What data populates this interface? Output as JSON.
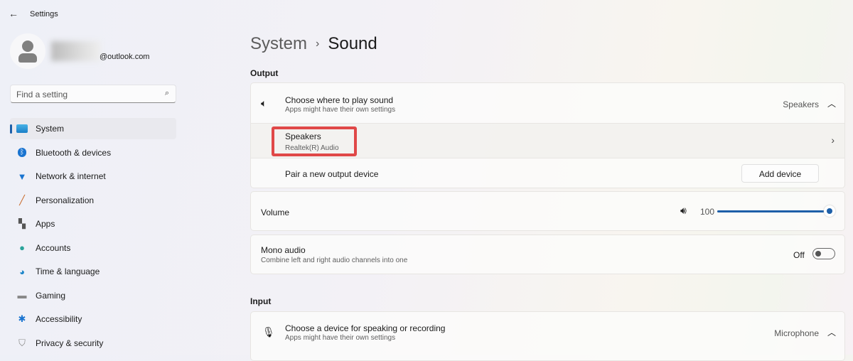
{
  "app": {
    "title": "Settings"
  },
  "account": {
    "email": "@outlook.com"
  },
  "search": {
    "placeholder": "Find a setting"
  },
  "nav": [
    {
      "label": "System",
      "icon": "monitor-icon",
      "selected": true
    },
    {
      "label": "Bluetooth & devices",
      "icon": "bluetooth-icon"
    },
    {
      "label": "Network & internet",
      "icon": "wifi-icon"
    },
    {
      "label": "Personalization",
      "icon": "brush-icon"
    },
    {
      "label": "Apps",
      "icon": "apps-icon"
    },
    {
      "label": "Accounts",
      "icon": "account-icon"
    },
    {
      "label": "Time & language",
      "icon": "globe-clock-icon"
    },
    {
      "label": "Gaming",
      "icon": "gamepad-icon"
    },
    {
      "label": "Accessibility",
      "icon": "accessibility-icon"
    },
    {
      "label": "Privacy & security",
      "icon": "shield-icon"
    }
  ],
  "breadcrumb": {
    "parent": "System",
    "sep": "›",
    "current": "Sound"
  },
  "output": {
    "heading": "Output",
    "choose": {
      "title": "Choose where to play sound",
      "subtitle": "Apps might have their own settings",
      "value": "Speakers"
    },
    "device": {
      "name": "Speakers",
      "driver": "Realtek(R) Audio"
    },
    "pair": {
      "label": "Pair a new output device",
      "button": "Add device"
    },
    "volume": {
      "label": "Volume",
      "value": "100",
      "percent": 100
    },
    "mono": {
      "title": "Mono audio",
      "subtitle": "Combine left and right audio channels into one",
      "state": "Off"
    }
  },
  "input": {
    "heading": "Input",
    "choose": {
      "title": "Choose a device for speaking or recording",
      "subtitle": "Apps might have their own settings",
      "value": "Microphone"
    }
  },
  "colors": {
    "accent": "#1d5fa8",
    "highlight": "#e04848"
  }
}
